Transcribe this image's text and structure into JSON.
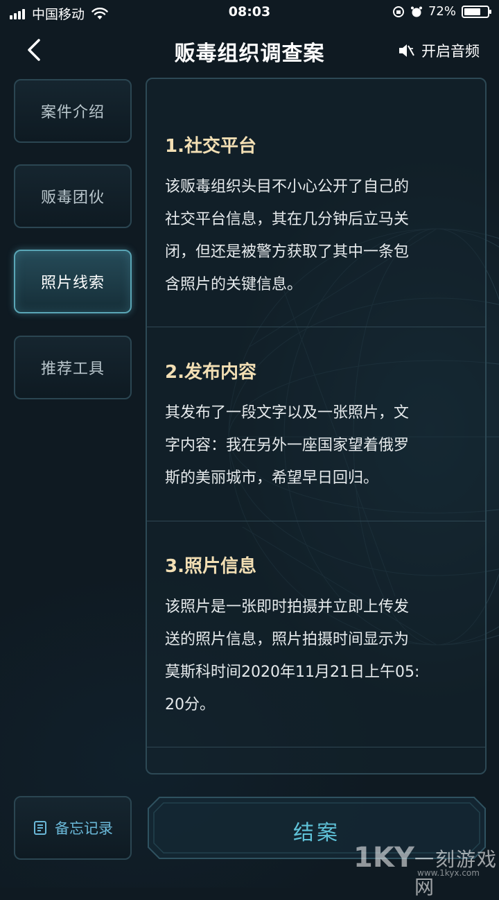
{
  "status_bar": {
    "carrier": "中国移动",
    "time": "08:03",
    "battery": "72%",
    "battery_level": 0.72
  },
  "header": {
    "title": "贩毒组织调查案",
    "sound_label": "开启音频"
  },
  "sidebar": {
    "tabs": [
      {
        "label": "案件介绍",
        "active": false
      },
      {
        "label": "贩毒团伙",
        "active": false
      },
      {
        "label": "照片线索",
        "active": true
      },
      {
        "label": "推荐工具",
        "active": false
      }
    ]
  },
  "content": {
    "sections": [
      {
        "title": "1.社交平台",
        "lines": [
          "该贩毒组织头目不小心公开了自己的",
          "社交平台信息，其在几分钟后立马关",
          "闭，但还是被警方获取了其中一条包",
          "含照片的关键信息。"
        ]
      },
      {
        "title": "2.发布内容",
        "lines": [
          "其发布了一段文字以及一张照片，文",
          "字内容：我在另外一座国家望着俄罗",
          "斯的美丽城市，希望早日回归。"
        ]
      },
      {
        "title": "3.照片信息",
        "lines": [
          "该照片是一张即时拍摄并立即上传发",
          "送的照片信息，照片拍摄时间显示为",
          "莫斯科时间2020年11月21日上午05:",
          "20分。"
        ]
      }
    ]
  },
  "footer": {
    "memo_label": "备忘记录",
    "close_case_label": "结案"
  },
  "watermark": {
    "logo": "1KY",
    "text": "一刻游戏网",
    "url": "www.1kyx.com"
  }
}
